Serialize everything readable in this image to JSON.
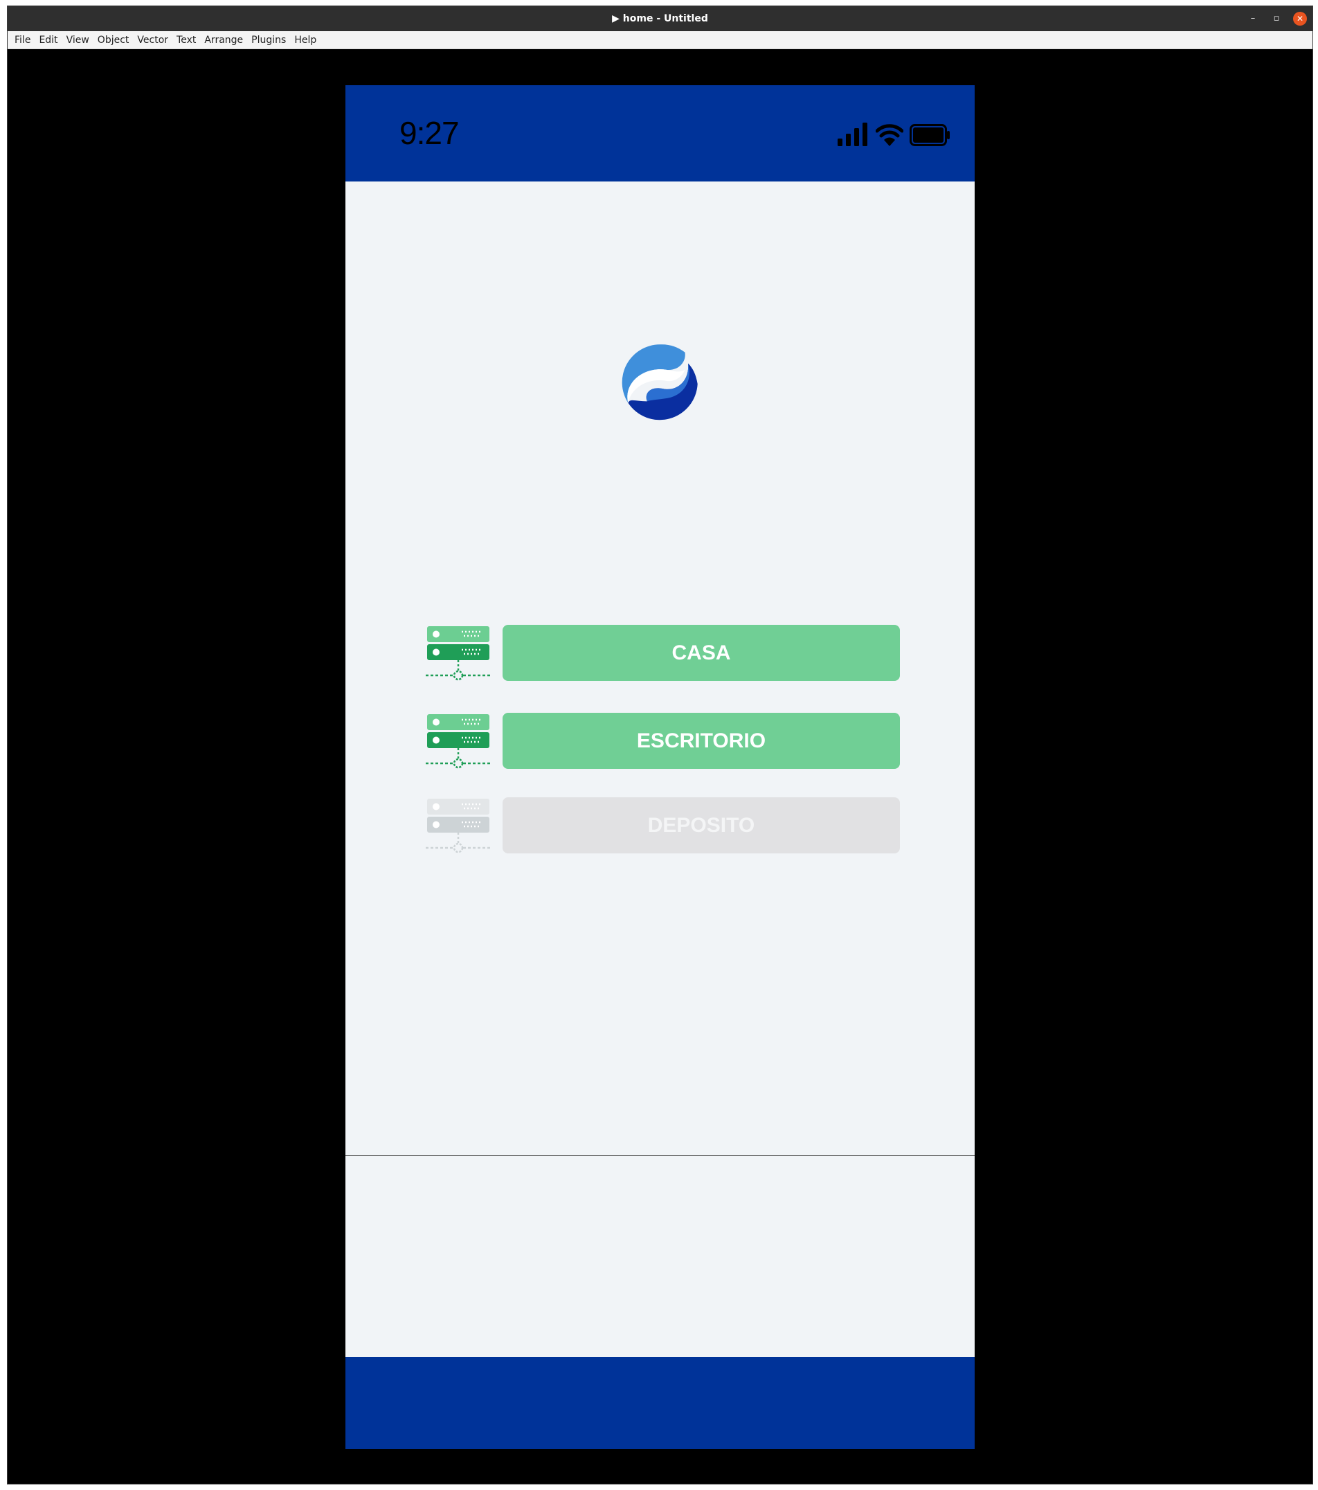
{
  "window": {
    "title": "▶ home - Untitled",
    "minimize_label": "–",
    "maximize_label": "▫",
    "close_label": "✕"
  },
  "menu": [
    "File",
    "Edit",
    "View",
    "Object",
    "Vector",
    "Text",
    "Arrange",
    "Plugins",
    "Help"
  ],
  "phone": {
    "status_time": "9:27",
    "status_icons": [
      "signal-icon",
      "wifi-icon",
      "battery-icon"
    ],
    "logo_icon": "logo-icon",
    "locations": [
      {
        "label": "CASA",
        "state": "active",
        "icon": "server-icon"
      },
      {
        "label": "ESCRITORIO",
        "state": "active",
        "icon": "server-icon"
      },
      {
        "label": "DEPOSITO",
        "state": "disabled",
        "icon": "server-icon"
      }
    ]
  },
  "colors": {
    "brand_blue": "#003399",
    "button_green": "#70cf95",
    "server_dark_green": "#1f9e57",
    "server_light_green": "#6cce92",
    "disabled_gray": "#e1e1e3",
    "background": "#f1f4f7"
  }
}
